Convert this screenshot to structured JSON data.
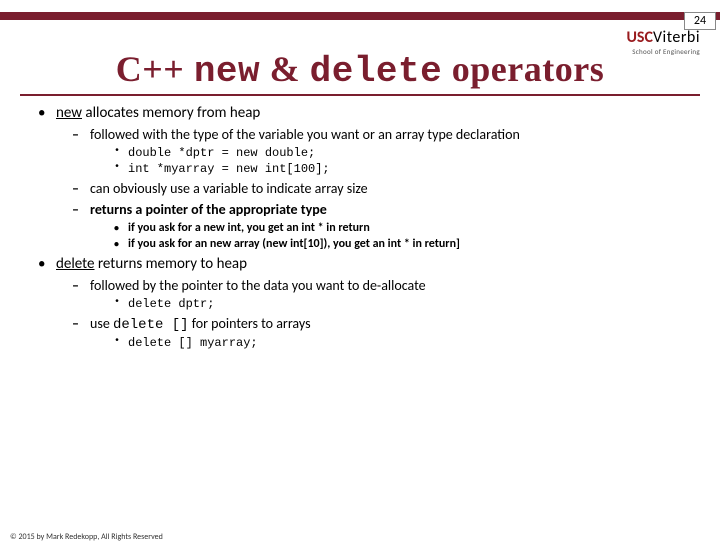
{
  "page_number": "24",
  "logo": {
    "usc": "USC",
    "viterbi": "Viterbi",
    "sub": "School of Engineering"
  },
  "title": {
    "pre": "C++ ",
    "kw1": "new",
    "mid": " & ",
    "kw2": "delete",
    "post": " operators"
  },
  "b1": {
    "new_u": "new",
    "new_rest": " allocates memory from heap",
    "sub1": "followed with the type of the variable you want or an array type declaration",
    "code1": "double *dptr = new double;",
    "code2": "int *myarray = new int[100];",
    "sub2": "can obviously use a variable to indicate array size",
    "sub3": "returns a pointer of the appropriate type",
    "ret1": "if you ask for a new int, you get an int * in return",
    "ret2": "if you ask for an new  array (new int[10]), you get an int * in return]"
  },
  "b2": {
    "del_u": "delete",
    "del_rest": " returns memory to heap",
    "sub1": "followed by the pointer to the data you want to de-allocate",
    "code1": "delete dptr;",
    "sub2_pre": "use ",
    "sub2_code": "delete []",
    "sub2_post": "  for pointers to arrays",
    "code2": "delete [] myarray;"
  },
  "footer": "© 2015 by Mark Redekopp, All Rights Reserved"
}
